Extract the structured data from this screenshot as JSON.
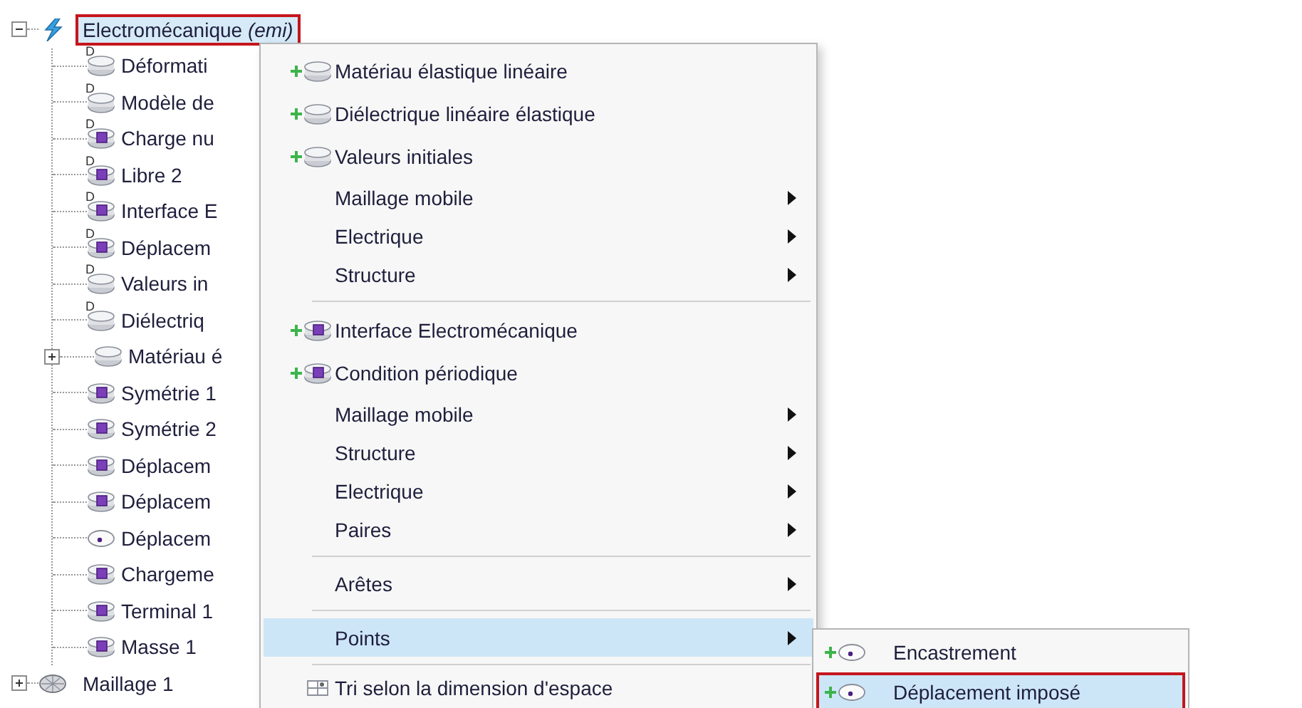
{
  "tree": [
    {
      "label": "Electromécanique *(emi)*",
      "kind": "physics",
      "expanded": true,
      "selected": true,
      "outlined": true,
      "children": [
        {
          "label": "Déformati",
          "kind": "domain",
          "badge": "D"
        },
        {
          "label": "Modèle de",
          "kind": "domain",
          "badge": "D"
        },
        {
          "label": "Charge nu",
          "kind": "boundary",
          "badge": "D"
        },
        {
          "label": "Libre 2",
          "kind": "boundary",
          "badge": "D"
        },
        {
          "label": "Interface E",
          "kind": "boundary",
          "badge": "D"
        },
        {
          "label": "Déplacem",
          "kind": "boundary",
          "badge": "D"
        },
        {
          "label": "Valeurs in",
          "kind": "domain",
          "badge": "D"
        },
        {
          "label": "Diélectriq",
          "kind": "domain",
          "badge": "D"
        },
        {
          "label": "Matériau é",
          "kind": "domain",
          "expanded": false
        },
        {
          "label": "Symétrie 1",
          "kind": "boundary"
        },
        {
          "label": "Symétrie 2",
          "kind": "boundary"
        },
        {
          "label": "Déplacem",
          "kind": "boundary"
        },
        {
          "label": "Déplacem",
          "kind": "boundary"
        },
        {
          "label": "Déplacem",
          "kind": "point"
        },
        {
          "label": "Chargeme",
          "kind": "boundary"
        },
        {
          "label": "Terminal 1",
          "kind": "boundary"
        },
        {
          "label": "Masse 1",
          "kind": "boundary"
        }
      ]
    },
    {
      "label": "Maillage 1",
      "kind": "mesh",
      "expanded": false,
      "selected": false,
      "outlined": false
    }
  ],
  "menu": {
    "groups": [
      [
        {
          "label": "Matériau élastique linéaire",
          "kind": "domain",
          "add": true,
          "submenu": false,
          "selected": false
        },
        {
          "label": "Diélectrique linéaire élastique",
          "kind": "domain",
          "add": true,
          "submenu": false,
          "selected": false
        },
        {
          "label": "Valeurs initiales",
          "kind": "domain",
          "add": true,
          "submenu": false,
          "selected": false
        },
        {
          "label": "Maillage mobile",
          "submenu": true,
          "selected": false
        },
        {
          "label": "Electrique",
          "submenu": true,
          "selected": false
        },
        {
          "label": "Structure",
          "submenu": true,
          "selected": false
        }
      ],
      [
        {
          "label": "Interface Electromécanique",
          "kind": "boundary",
          "add": true,
          "submenu": false,
          "selected": false
        },
        {
          "label": "Condition périodique",
          "kind": "boundary",
          "add": true,
          "submenu": false,
          "selected": false
        },
        {
          "label": "Maillage mobile",
          "submenu": true,
          "selected": false
        },
        {
          "label": "Structure",
          "submenu": true,
          "selected": false
        },
        {
          "label": "Electrique",
          "submenu": true,
          "selected": false
        },
        {
          "label": "Paires",
          "submenu": true,
          "selected": false
        }
      ],
      [
        {
          "label": "Arêtes",
          "submenu": true,
          "selected": false
        }
      ],
      [
        {
          "label": "Points",
          "submenu": true,
          "selected": true
        }
      ],
      [
        {
          "label": "Tri selon la dimension d'espace",
          "kind": "sort",
          "submenu": false,
          "selected": false
        }
      ]
    ]
  },
  "submenu": {
    "items": [
      {
        "label": "Encastrement",
        "kind": "point",
        "add": true,
        "selected": false,
        "outlined": false
      },
      {
        "label": "Déplacement imposé",
        "kind": "point",
        "add": true,
        "selected": true,
        "outlined": true
      }
    ]
  }
}
